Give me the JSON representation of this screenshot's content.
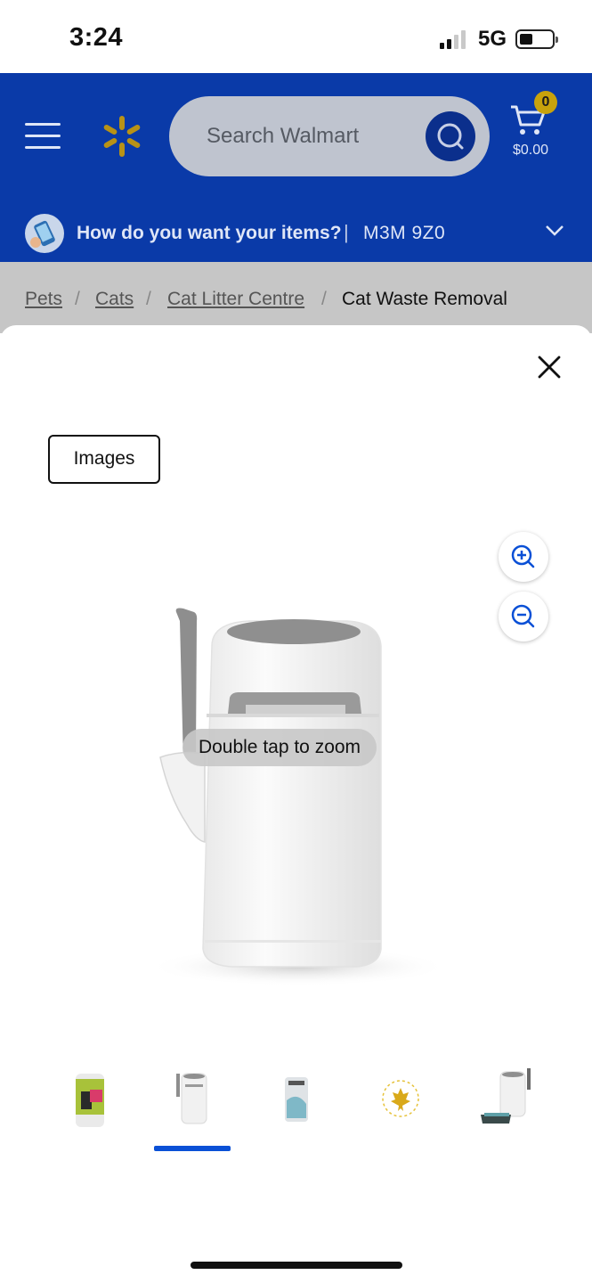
{
  "status_bar": {
    "time": "3:24",
    "network": "5G"
  },
  "header": {
    "search_placeholder": "Search Walmart",
    "cart_count": "0",
    "cart_total": "$0.00",
    "delivery_prompt": "How do you want your items?",
    "delivery_separator": "|",
    "postal_code": "M3M 9Z0",
    "brand_color": "#0a3aa8",
    "accent_color": "#c8a20c"
  },
  "breadcrumb": {
    "items": [
      "Pets",
      "Cats",
      "Cat Litter Centre"
    ],
    "separator": "/",
    "current": "Cat Waste Removal"
  },
  "image_viewer": {
    "tab_label": "Images",
    "zoom_hint": "Double tap to zoom",
    "selected_thumbnail": 2,
    "thumbnails": [
      {
        "icon": "refill-cartridge-thumbnail"
      },
      {
        "icon": "litter-bin-thumbnail"
      },
      {
        "icon": "refill-bag-thumbnail"
      },
      {
        "icon": "canada-maple-leaf-badge-thumbnail"
      },
      {
        "icon": "bin-with-tray-thumbnail"
      }
    ]
  }
}
